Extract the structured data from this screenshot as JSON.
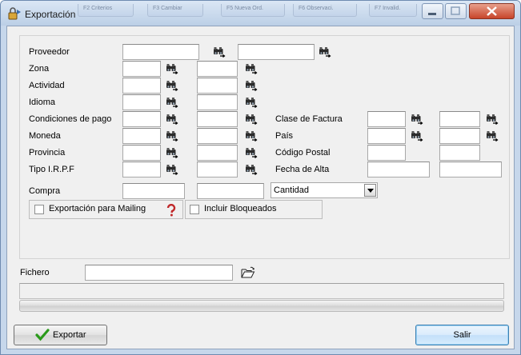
{
  "window": {
    "title": "Exportación",
    "ghost_tabs": [
      "F2 Criterios",
      "F3 Cambiar",
      "F5 Nueva Ord.",
      "F6 Observaci.",
      "F7 Invalid."
    ]
  },
  "form": {
    "proveedor_label": "Proveedor",
    "zona_label": "Zona",
    "actividad_label": "Actividad",
    "idioma_label": "Idioma",
    "condiciones_label": "Condiciones de pago",
    "moneda_label": "Moneda",
    "provincia_label": "Provincia",
    "tipo_irpf_label": "Tipo I.R.P.F",
    "compra_label": "Compra",
    "clase_factura_label": "Clase de Factura",
    "pais_label": "País",
    "codigo_postal_label": "Código Postal",
    "fecha_alta_label": "Fecha de Alta",
    "compra_combo_value": "Cantidad",
    "exportacion_mailing_label": "Exportación para Mailing",
    "incluir_bloqueados_label": "Incluir Bloqueados",
    "fichero_label": "Fichero"
  },
  "buttons": {
    "exportar": "Exportar",
    "salir": "Salir"
  },
  "colors": {
    "title_bar": "#c6d7eb",
    "close_button": "#c7442a",
    "focus_border": "#3c7fb1",
    "accept_check": "#2a9a1a"
  },
  "icons": {
    "lookup": "binoculars-icon",
    "help": "question-icon",
    "folder": "open-folder-icon",
    "accept": "checkmark-icon"
  }
}
